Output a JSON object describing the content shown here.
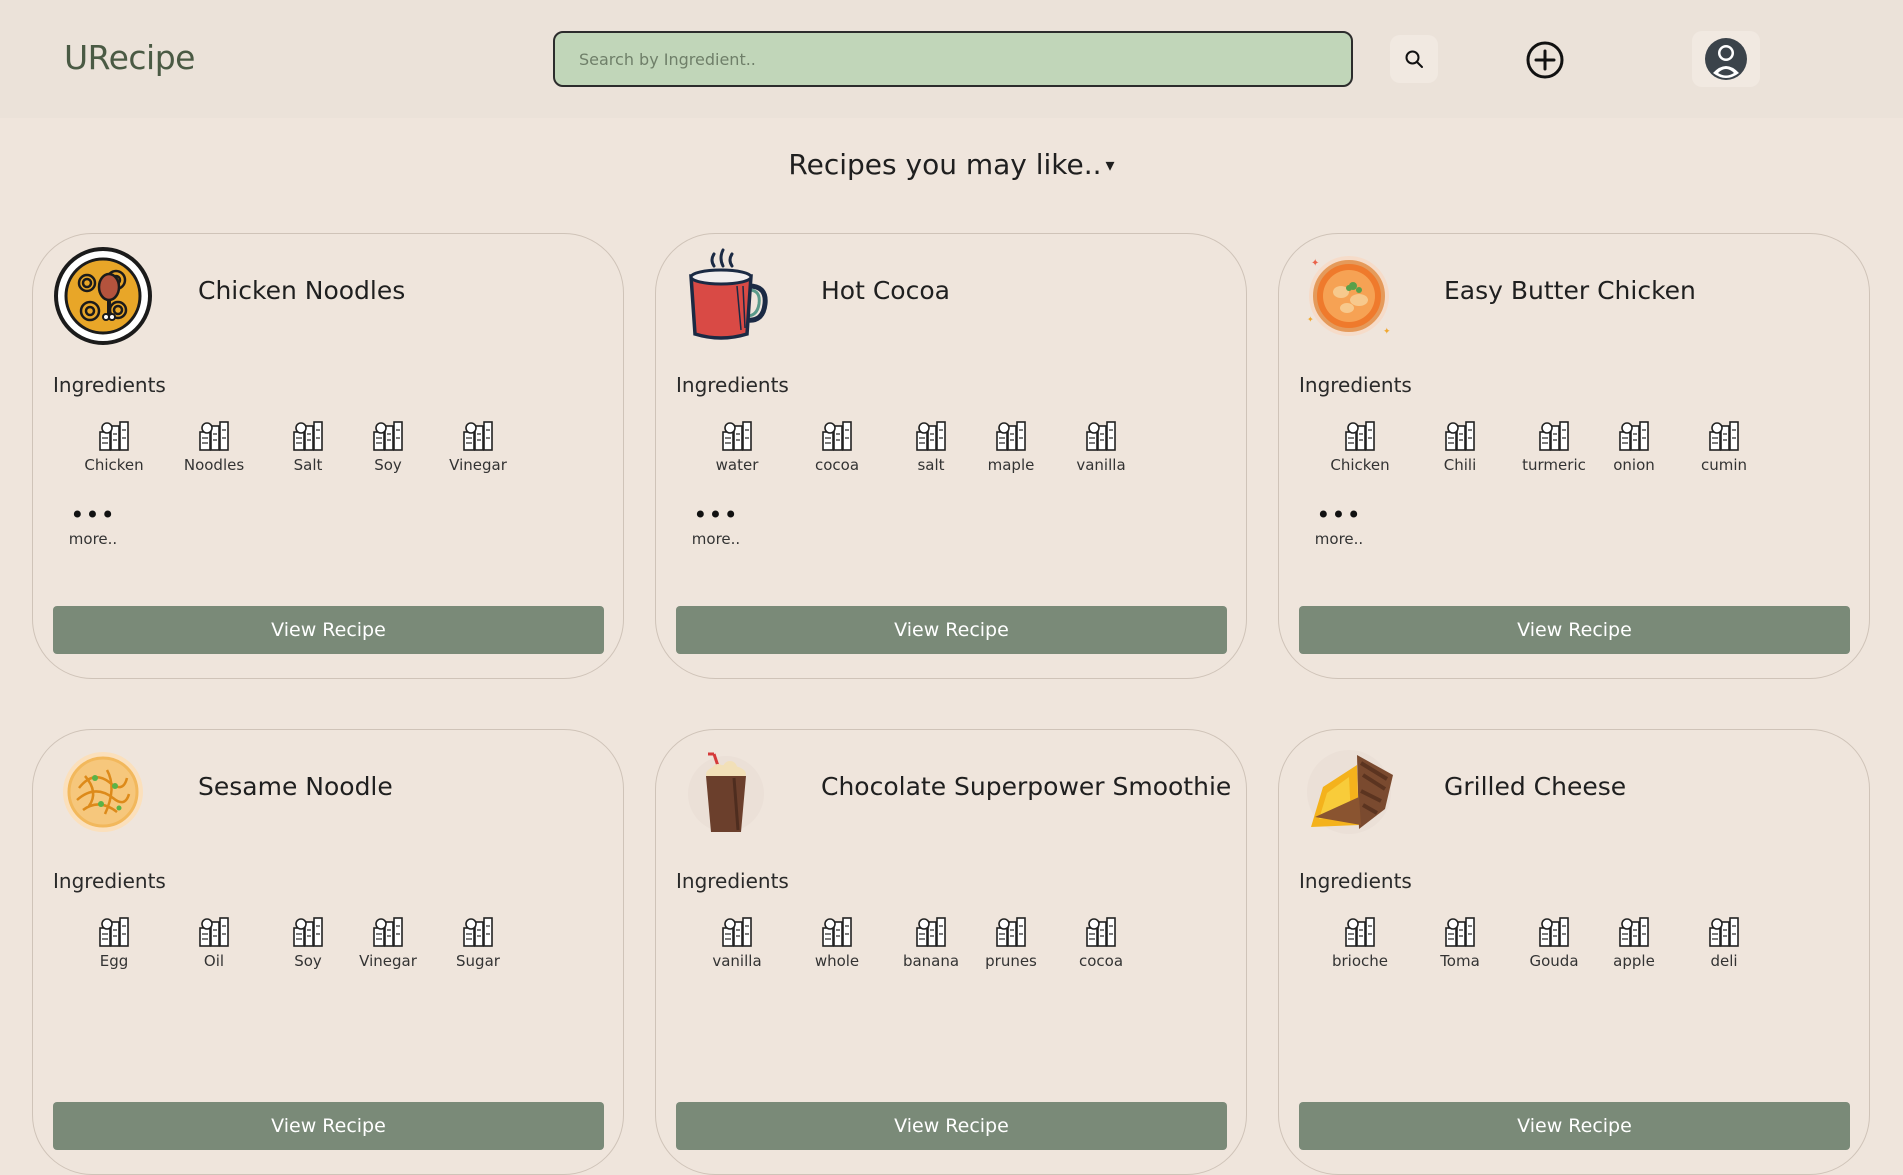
{
  "app": {
    "title": "URecipe"
  },
  "header": {
    "search_placeholder": "Search by Ingredient..",
    "icons": {
      "search": "search-icon",
      "add": "plus-circle-icon",
      "profile": "user-avatar-icon"
    }
  },
  "main": {
    "heading": "Recipes you may like..",
    "heading_caret": "▾",
    "ingredients_label": "Ingredients",
    "more_label": "more..",
    "view_label": "View Recipe",
    "cards": [
      {
        "title": "Chicken Noodles",
        "image": "noodle-bowl-icon",
        "ingredients": [
          "Chicken",
          "Noodles",
          "Salt",
          "Soy",
          "Vinegar"
        ],
        "has_more": true
      },
      {
        "title": "Hot Cocoa",
        "image": "mug-icon",
        "ingredients": [
          "water",
          "cocoa",
          "salt",
          "maple",
          "vanilla"
        ],
        "has_more": true
      },
      {
        "title": "Easy Butter Chicken",
        "image": "curry-bowl-icon",
        "ingredients": [
          "Chicken",
          "Chili",
          "turmeric",
          "onion",
          "cumin"
        ],
        "has_more": true
      },
      {
        "title": "Sesame Noodle",
        "image": "noodle-plate-icon",
        "ingredients": [
          "Egg",
          "Oil",
          "Soy",
          "Vinegar",
          "Sugar"
        ],
        "has_more": false
      },
      {
        "title": "Chocolate Superpower Smoothie",
        "image": "smoothie-cup-icon",
        "ingredients": [
          "vanilla",
          "whole",
          "banana",
          "prunes",
          "cocoa"
        ],
        "has_more": false
      },
      {
        "title": "Grilled Cheese",
        "image": "sandwich-icon",
        "ingredients": [
          "brioche",
          "Toma",
          "Gouda",
          "apple",
          "deli"
        ],
        "has_more": false
      }
    ]
  },
  "colors": {
    "background": "#efe5dc",
    "search_bg": "#c1d6b9",
    "button": "#7a8a78",
    "logo": "#4a5a44"
  }
}
